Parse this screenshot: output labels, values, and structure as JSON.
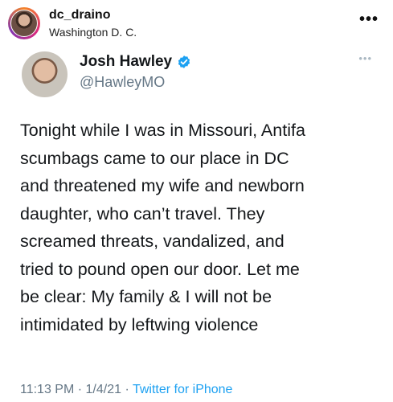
{
  "post": {
    "username": "dc_draino",
    "location": "Washington D. C.",
    "more": "•••"
  },
  "tweet": {
    "name": "Josh Hawley",
    "handle": "@HawleyMO",
    "more": "•••",
    "verified": true,
    "text": "Tonight while I was in Missouri, Antifa\nscumbags came to our place in DC\nand threatened my wife and newborn\ndaughter, who can’t travel. They\nscreamed threats, vandalized, and\ntried to pound open our door. Let me\nbe clear: My family & I will not be\nintimidated by leftwing violence",
    "time": "11:13 PM",
    "separator": "·",
    "date": "1/4/21",
    "source": "Twitter for iPhone"
  },
  "colors": {
    "verified": "#1da1f2",
    "link": "#1da1f2",
    "muted": "#657786"
  }
}
